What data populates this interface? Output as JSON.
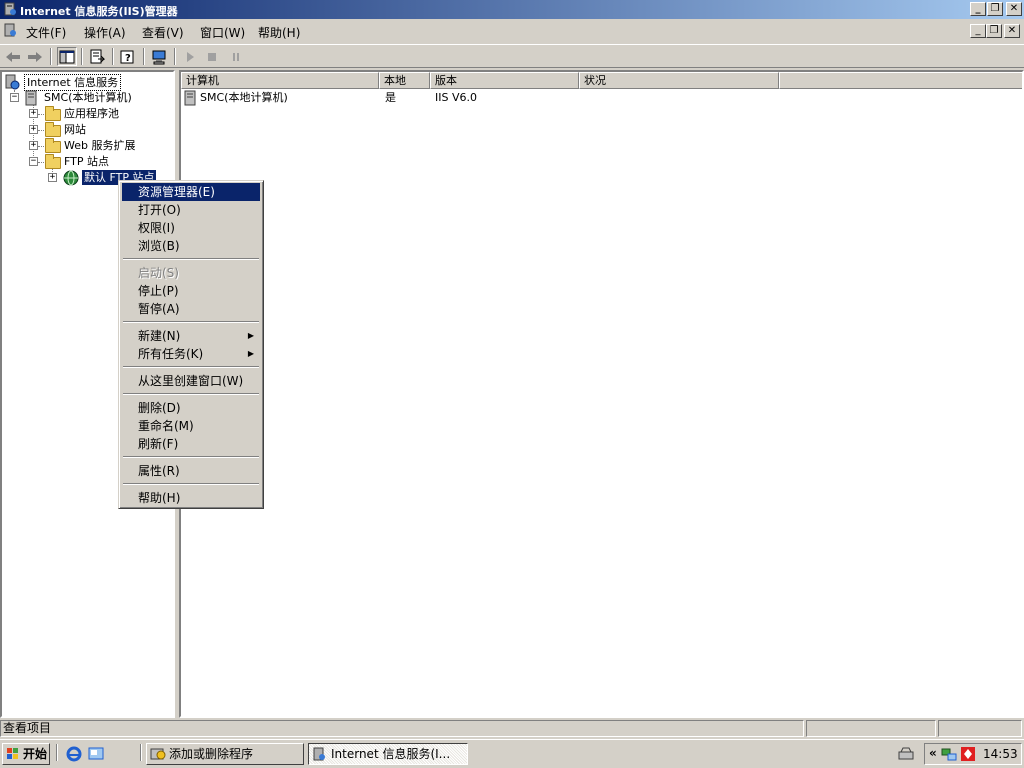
{
  "window": {
    "title": "Internet 信息服务(IIS)管理器",
    "caption_buttons": [
      "_",
      "❐",
      "✕"
    ]
  },
  "menubar": {
    "items": [
      "文件(F)",
      "操作(A)",
      "查看(V)",
      "窗口(W)",
      "帮助(H)"
    ],
    "mdi_buttons": [
      "_",
      "❐",
      "✕"
    ]
  },
  "tree": {
    "root": "Internet 信息服务",
    "server": "SMC(本地计算机)",
    "nodes": [
      "应用程序池",
      "网站",
      "Web 服务扩展",
      "FTP 站点"
    ],
    "ftp_child": "默认 FTP 站点"
  },
  "list": {
    "columns": [
      "计算机",
      "本地",
      "版本",
      "状况"
    ],
    "rows": [
      {
        "computer": "SMC(本地计算机)",
        "local": "是",
        "version": "IIS V6.0",
        "status": ""
      }
    ]
  },
  "context_menu": {
    "items": [
      {
        "label": "资源管理器(E)",
        "state": "selected"
      },
      {
        "label": "打开(O)",
        "state": "normal"
      },
      {
        "label": "权限(I)",
        "state": "normal"
      },
      {
        "label": "浏览(B)",
        "state": "normal"
      },
      {
        "label": "启动(S)",
        "state": "disabled"
      },
      {
        "label": "停止(P)",
        "state": "normal"
      },
      {
        "label": "暂停(A)",
        "state": "normal"
      },
      {
        "label": "新建(N)",
        "state": "submenu"
      },
      {
        "label": "所有任务(K)",
        "state": "submenu"
      },
      {
        "label": "从这里创建窗口(W)",
        "state": "normal"
      },
      {
        "label": "删除(D)",
        "state": "normal"
      },
      {
        "label": "重命名(M)",
        "state": "normal"
      },
      {
        "label": "刷新(F)",
        "state": "normal"
      },
      {
        "label": "属性(R)",
        "state": "normal"
      },
      {
        "label": "帮助(H)",
        "state": "normal"
      }
    ]
  },
  "statusbar": {
    "text": "查看项目"
  },
  "taskbar": {
    "start_label": "开始",
    "tasks": [
      "添加或删除程序",
      "Internet 信息服务(I..."
    ],
    "clock": "14:53",
    "tray_chevron": "«"
  },
  "colors": {
    "titlebar_start": "#0a246a",
    "titlebar_end": "#a6caf0",
    "selection": "#0a246a",
    "face": "#d4d0c8"
  }
}
